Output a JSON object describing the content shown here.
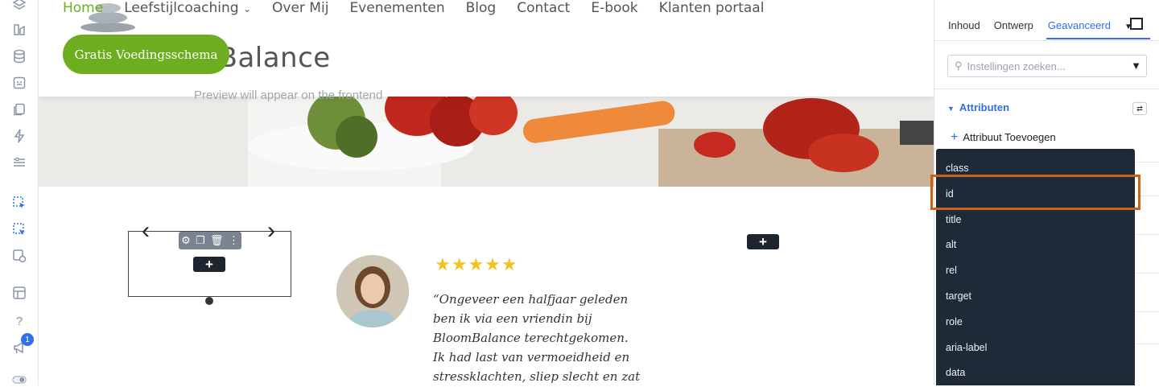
{
  "nav": {
    "home": "Home",
    "lifestyle": "Leefstijlcoaching",
    "about": "Over Mij",
    "events": "Evenementen",
    "blog": "Blog",
    "contact": "Contact",
    "ebook": "E-book",
    "portal": "Klanten portaal"
  },
  "brand_text": "mBalance",
  "preview_text": "Preview will appear on the frontend",
  "cta_label": "Gratis Voedingsschema",
  "testimonial": {
    "stars": "★★★★★",
    "quote": "“Ongeveer een halfjaar geleden ben ik via een vriendin bij BloomBalance terechtgekomen. Ik had last van vermoeidheid en stressklachten, sliep slecht en zat niet lekker in mijn vel."
  },
  "sidebar_badge": "1",
  "panel": {
    "tabs": {
      "content": "Inhoud",
      "design": "Ontwerp",
      "advanced": "Geavanceerd"
    },
    "search_placeholder": "Instellingen zoeken...",
    "section_title": "Attributen",
    "add_attribute": "Attribuut Toevoegen"
  },
  "attribute_options": [
    "class",
    "id",
    "title",
    "alt",
    "rel",
    "target",
    "role",
    "aria-label",
    "data"
  ],
  "colors": {
    "accent": "#2f6fed",
    "brand_green": "#6cae1f",
    "dropdown_bg": "#1f2a38",
    "highlight": "#c8621a"
  }
}
